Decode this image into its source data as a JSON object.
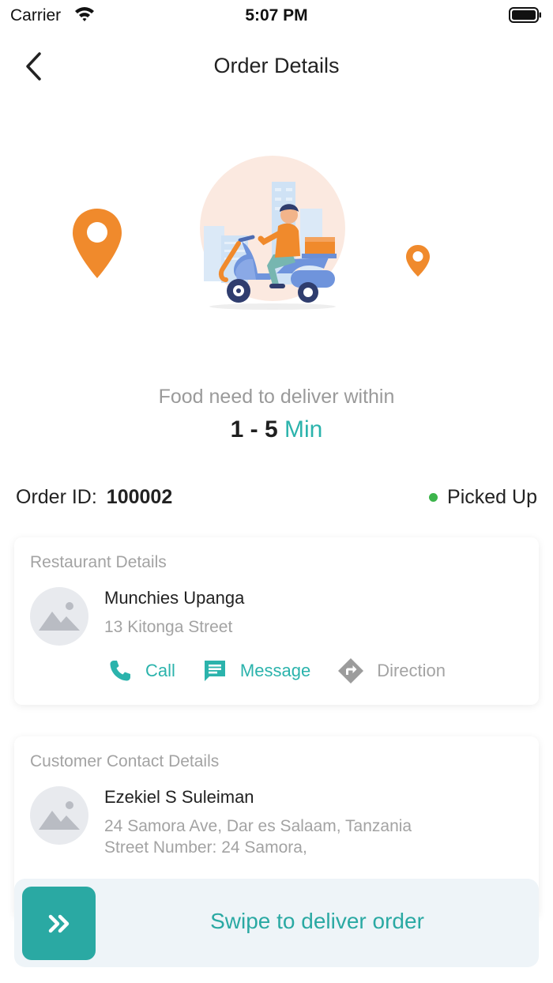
{
  "status_bar": {
    "carrier": "Carrier",
    "time": "5:07 PM"
  },
  "nav": {
    "title": "Order Details"
  },
  "delivery": {
    "message": "Food need to deliver within",
    "eta_range": "1 - 5",
    "eta_unit": "Min"
  },
  "order": {
    "id_label": "Order ID:",
    "id_value": "100002",
    "status": "Picked Up",
    "status_color": "#3cb44b"
  },
  "restaurant": {
    "heading": "Restaurant Details",
    "name": "Munchies Upanga",
    "address": "13 Kitonga Street",
    "actions": [
      {
        "label": "Call",
        "icon": "phone-icon"
      },
      {
        "label": "Message",
        "icon": "message-icon"
      },
      {
        "label": "Direction",
        "icon": "direction-icon"
      }
    ]
  },
  "customer": {
    "heading": "Customer Contact Details",
    "name": "Ezekiel S Suleiman",
    "address_line1": "24 Samora Ave, Dar es Salaam, Tanzania",
    "address_line2": "Street Number: 24 Samora,"
  },
  "swipe": {
    "label": "Swipe to deliver order"
  },
  "colors": {
    "accent": "#2bb3ac",
    "pin": "#f08a2c",
    "muted_text": "#a3a3a3"
  }
}
